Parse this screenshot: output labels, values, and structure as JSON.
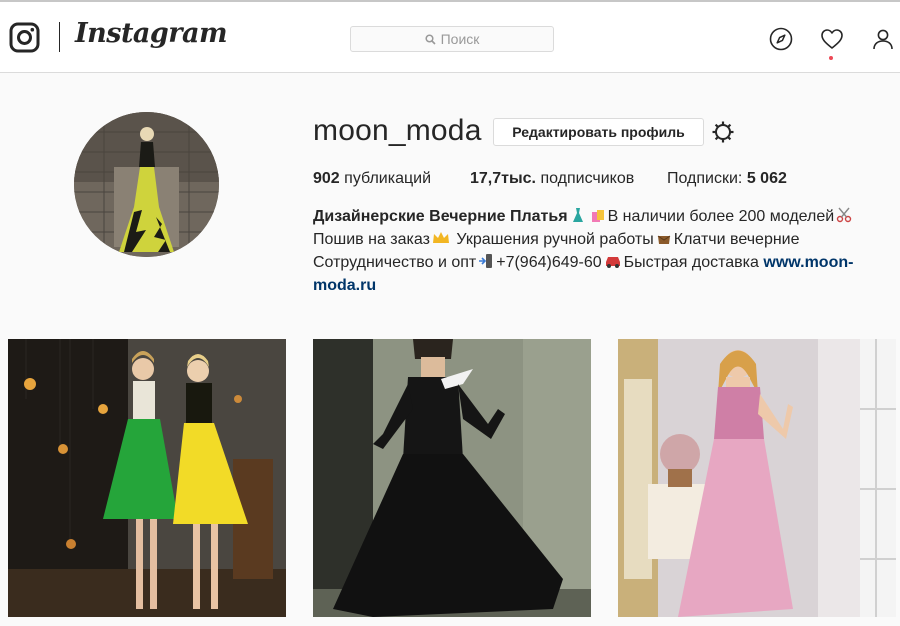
{
  "header": {
    "brand": "Instagram",
    "search": {
      "placeholder": "Поиск"
    },
    "nav": {
      "explore_icon": "compass-icon",
      "activity_icon": "heart-icon",
      "profile_icon": "user-icon"
    }
  },
  "profile": {
    "username": "moon_moda",
    "edit_button": "Редактировать профиль",
    "settings_icon": "gear-icon",
    "stats": {
      "posts_count": "902",
      "posts_label": "публикаций",
      "followers_count": "17,7тыс.",
      "followers_label": "подписчиков",
      "following_label": "Подписки:",
      "following_count": "5 062"
    },
    "bio": {
      "title": "Дизайнерские Вечерние Платья",
      "line1_rest": "В наличии более 200 моделей",
      "line2_a": "Пошив на заказ",
      "line2_b": "Украшения ручной работы",
      "line2_c": "Клатчи вечерние",
      "line3_a": "Сотрудничество и опт",
      "line3_b": "+7(964)649-60",
      "line3_c": "Быстрая доставка",
      "link_part1": "www.moon-",
      "link_part2": "moda.ru"
    }
  },
  "posts": [
    {
      "icon": "photo-two-women-green-yellow-dresses"
    },
    {
      "icon": "photo-woman-black-gown"
    },
    {
      "icon": "photo-woman-pink-gown"
    }
  ],
  "colors": {
    "accent_link": "#003569",
    "notification": "#ed4956",
    "border": "#dbdbdb"
  }
}
